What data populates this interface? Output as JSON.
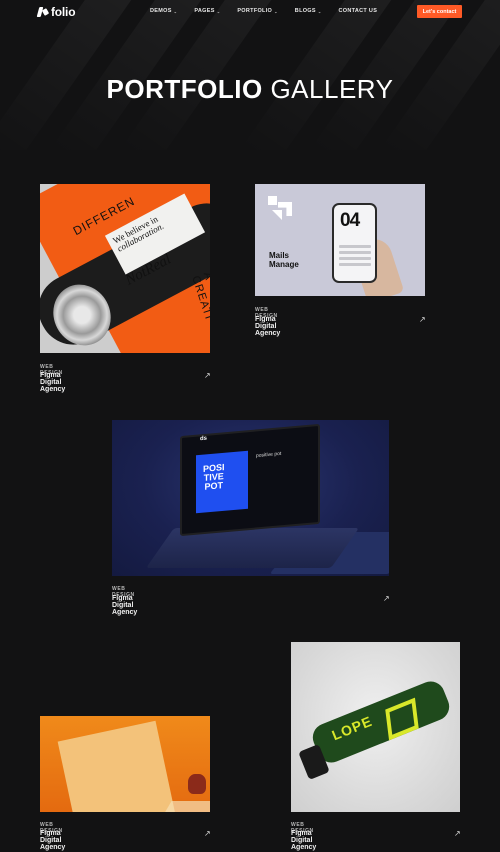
{
  "brand": {
    "name": "folio"
  },
  "nav": {
    "items": [
      {
        "label": "DEMOS",
        "caret": "⌄"
      },
      {
        "label": "PAGES",
        "caret": "⌄"
      },
      {
        "label": "PORTFOLIO",
        "caret": "⌄"
      },
      {
        "label": "BLOGS",
        "caret": "⌄"
      },
      {
        "label": "CONTACT US",
        "caret": ""
      }
    ],
    "cta_label": "Let's contact"
  },
  "hero": {
    "title_bold": "PORTFOLIO",
    "title_light": "GALLERY"
  },
  "cards": [
    {
      "category": "WEB DESIGN",
      "title": "Figma Digital Agency",
      "arrow": "↗",
      "image": {
        "lines": [
          "We believe in",
          "collaboration."
        ],
        "brand": "NotReal",
        "diff": "DIFFEREN",
        "creat": "A CREATI"
      }
    },
    {
      "category": "WEB DESIGN",
      "title": "Figma Digital Agency",
      "arrow": "↗",
      "image": {
        "heading": "Mails",
        "heading2": "Manage",
        "number": "04"
      }
    },
    {
      "category": "WEB DESIGN",
      "title": "Figma Digital Agency",
      "arrow": "↗",
      "image": {
        "screen_lines": [
          "POSI",
          "TIVE",
          "POT"
        ],
        "logo": "ds",
        "side_text": "positive pot"
      }
    },
    {
      "category": "WEB DESIGN",
      "title": "Figma Digital Agency",
      "arrow": "↗",
      "image": {}
    },
    {
      "category": "WEB DESIGN",
      "title": "Figma Digital Agency",
      "arrow": "↗",
      "image": {
        "word": "LOPE"
      }
    }
  ],
  "colors": {
    "background": "#121213",
    "accent": "#ff5a26"
  }
}
